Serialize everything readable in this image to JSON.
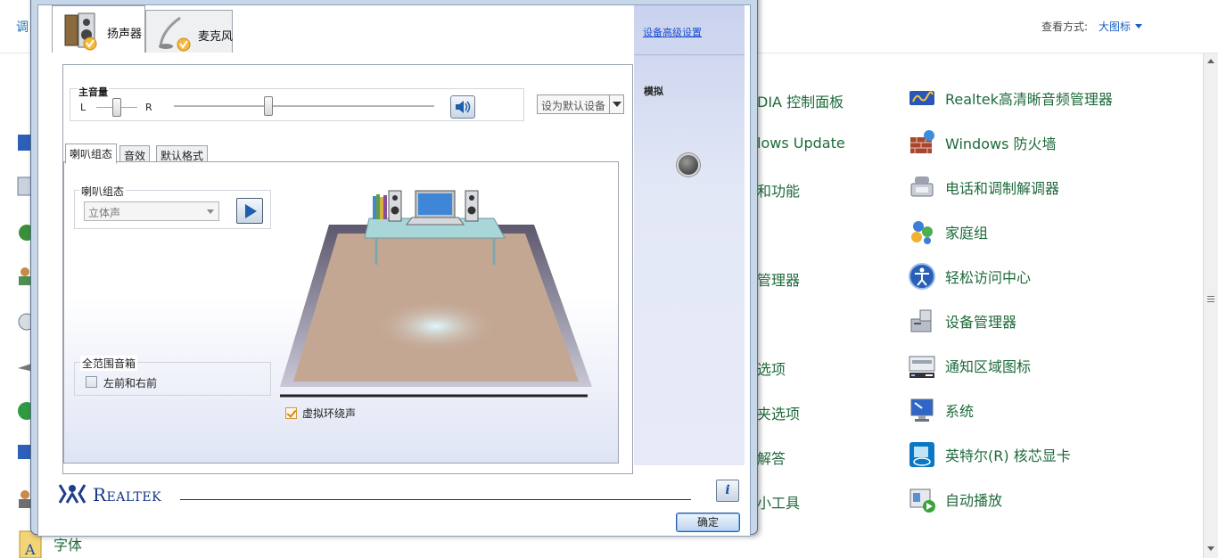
{
  "control_panel": {
    "adjust_label": "调",
    "view_by_label": "查看方式:",
    "view_by_value": "大图标",
    "items_right": [
      {
        "label": "Realtek高清晰音频管理器",
        "icon": "realtek-audio-icon"
      },
      {
        "label": "Windows 防火墙",
        "icon": "firewall-icon"
      },
      {
        "label": "电话和调制解调器",
        "icon": "phone-modem-icon"
      },
      {
        "label": "家庭组",
        "icon": "homegroup-icon"
      },
      {
        "label": "轻松访问中心",
        "icon": "ease-of-access-icon"
      },
      {
        "label": "设备管理器",
        "icon": "device-manager-icon"
      },
      {
        "label": "通知区域图标",
        "icon": "notification-icons-icon"
      },
      {
        "label": "系统",
        "icon": "system-icon"
      },
      {
        "label": "英特尔(R) 核芯显卡",
        "icon": "intel-graphics-icon"
      },
      {
        "label": "自动播放",
        "icon": "autoplay-icon"
      }
    ],
    "items_middle_fragments": [
      "DIA 控制面板",
      "lows Update",
      "和功能",
      "管理器",
      "选项",
      "夹选项",
      "解答",
      "小工具"
    ],
    "bottom_item": "字体"
  },
  "dialog": {
    "tabs": [
      {
        "label": "扬声器",
        "icon": "speaker-icon"
      },
      {
        "label": "麦克风",
        "icon": "microphone-icon"
      }
    ],
    "master_volume": {
      "title": "主音量",
      "left_label": "L",
      "right_label": "R",
      "balance": 0.5,
      "level": 0.37
    },
    "default_device_button": "设为默认设备",
    "subtabs": [
      "喇叭组态",
      "音效",
      "默认格式"
    ],
    "speaker_config": {
      "group_title": "喇叭组态",
      "selected": "立体声"
    },
    "fullrange": {
      "group_title": "全范围音箱",
      "checkbox_label": "左前和右前",
      "checked": false
    },
    "virtual_surround": {
      "label": "虚拟环绕声",
      "checked": true
    },
    "right_panel": {
      "advanced_link": "设备高级设置",
      "analog_label": "模拟"
    },
    "brand": "Realtek",
    "info_button": "i",
    "ok_button": "确定"
  }
}
